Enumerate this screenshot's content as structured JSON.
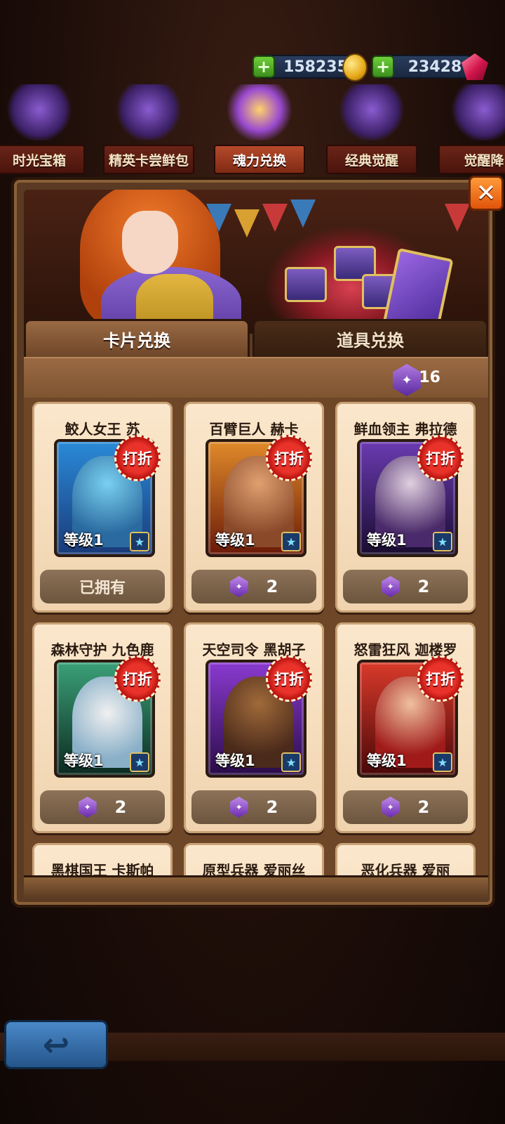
{
  "currency": {
    "coins": "158235",
    "gems": "23428",
    "coin_icon": "coin-icon",
    "gem_icon": "gem-icon"
  },
  "event_tabs": [
    {
      "label": "时光宝箱",
      "active": false
    },
    {
      "label": "精英卡尝鲜包",
      "active": false
    },
    {
      "label": "魂力兑换",
      "active": true
    },
    {
      "label": "经典觉醒",
      "active": false
    },
    {
      "label": "觉醒降",
      "active": false
    }
  ],
  "tabs": {
    "card_exchange": "卡片兑换",
    "item_exchange": "道具兑换"
  },
  "soul_balance": "16",
  "cards": [
    {
      "name": "鲛人女王 苏",
      "level": "等级1",
      "badge": "打折",
      "action": "已拥有",
      "owned": true,
      "color_a": "#2a8ad8",
      "color_b": "#5a3aa0"
    },
    {
      "name": "百臂巨人 赫卡",
      "level": "等级1",
      "badge": "打折",
      "action": "2",
      "owned": false,
      "color_a": "#e08a2a",
      "color_b": "#8a2a0c"
    },
    {
      "name": "鲜血领主 弗拉德",
      "level": "等级1",
      "badge": "打折",
      "action": "2",
      "owned": false,
      "color_a": "#6a3ab0",
      "color_b": "#2a1448"
    },
    {
      "name": "森林守护 九色鹿",
      "level": "等级1",
      "badge": "打折",
      "action": "2",
      "owned": false,
      "color_a": "#3aa078",
      "color_b": "#1a4a38"
    },
    {
      "name": "天空司令 黑胡子",
      "level": "等级1",
      "badge": "打折",
      "action": "2",
      "owned": false,
      "color_a": "#8a3ad0",
      "color_b": "#3a1a6a"
    },
    {
      "name": "怒雷狂风 迦楼罗",
      "level": "等级1",
      "badge": "打折",
      "action": "2",
      "owned": false,
      "color_a": "#d83a2a",
      "color_b": "#6a0c0c"
    },
    {
      "name": "黑棋国王 卡斯帕",
      "level": "",
      "badge": "",
      "action": "",
      "owned": false,
      "color_a": "#444",
      "color_b": "#222"
    },
    {
      "name": "原型兵器 爱丽丝",
      "level": "",
      "badge": "",
      "action": "",
      "owned": false,
      "color_a": "#444",
      "color_b": "#222"
    },
    {
      "name": "恶化兵器 爱丽",
      "level": "",
      "badge": "",
      "action": "",
      "owned": false,
      "color_a": "#444",
      "color_b": "#222"
    }
  ],
  "close_label": "✕",
  "back_label": "↩"
}
